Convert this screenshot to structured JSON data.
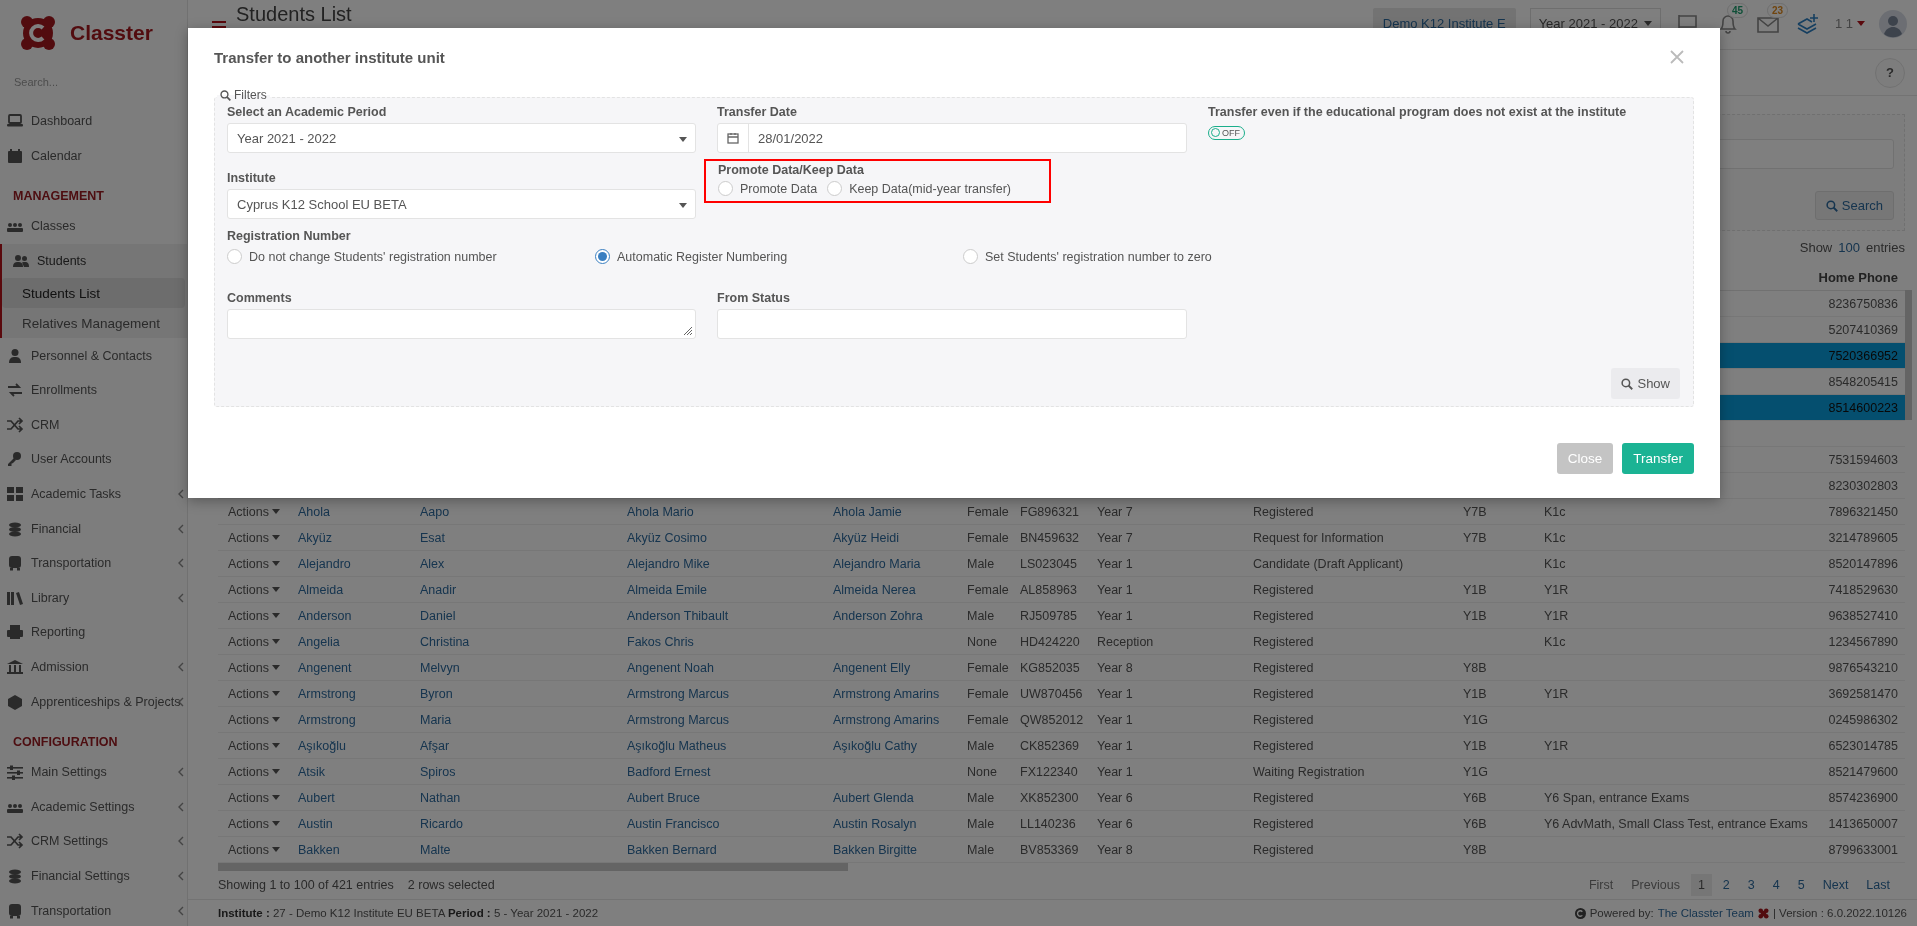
{
  "brand": {
    "name": "Classter",
    "search_placeholder": "Search..."
  },
  "sidebar": [
    {
      "kind": "item",
      "label": "Dashboard",
      "selected": false,
      "has_submenu": false
    },
    {
      "kind": "item",
      "label": "Calendar",
      "selected": false,
      "has_submenu": false
    },
    {
      "kind": "section",
      "label": "MANAGEMENT"
    },
    {
      "kind": "item",
      "label": "Classes",
      "selected": false,
      "has_submenu": false
    },
    {
      "kind": "item",
      "label": "Students",
      "selected": true,
      "has_submenu": false,
      "expanded": true,
      "children": [
        {
          "label": "Students List",
          "selected": true
        },
        {
          "label": "Relatives Management",
          "selected": false
        }
      ]
    },
    {
      "kind": "item",
      "label": "Personnel & Contacts",
      "selected": false,
      "has_submenu": false
    },
    {
      "kind": "item",
      "label": "Enrollments",
      "selected": false,
      "has_submenu": false
    },
    {
      "kind": "item",
      "label": "CRM",
      "selected": false,
      "has_submenu": false
    },
    {
      "kind": "item",
      "label": "User Accounts",
      "selected": false,
      "has_submenu": false
    },
    {
      "kind": "item",
      "label": "Academic Tasks",
      "selected": false,
      "has_submenu": true
    },
    {
      "kind": "item",
      "label": "Financial",
      "selected": false,
      "has_submenu": true
    },
    {
      "kind": "item",
      "label": "Transportation",
      "selected": false,
      "has_submenu": true
    },
    {
      "kind": "item",
      "label": "Library",
      "selected": false,
      "has_submenu": true
    },
    {
      "kind": "item",
      "label": "Reporting",
      "selected": false,
      "has_submenu": false
    },
    {
      "kind": "item",
      "label": "Admission",
      "selected": false,
      "has_submenu": true
    },
    {
      "kind": "item",
      "label": "Apprenticeships & Projects",
      "selected": false,
      "has_submenu": true
    },
    {
      "kind": "section",
      "label": "CONFIGURATION"
    },
    {
      "kind": "item",
      "label": "Main Settings",
      "selected": false,
      "has_submenu": true
    },
    {
      "kind": "item",
      "label": "Academic Settings",
      "selected": false,
      "has_submenu": true
    },
    {
      "kind": "item",
      "label": "CRM Settings",
      "selected": false,
      "has_submenu": true
    },
    {
      "kind": "item",
      "label": "Financial Settings",
      "selected": false,
      "has_submenu": true
    },
    {
      "kind": "item",
      "label": "Transportation",
      "selected": false,
      "has_submenu": true
    }
  ],
  "topbar": {
    "title": "Students List",
    "institute": "Demo K12 Institute E",
    "period": "Year 2021 - 2022",
    "notifications": "45",
    "messages": "23",
    "user": "1 1",
    "help": "?"
  },
  "filters": {
    "search_button": "Search"
  },
  "entries": {
    "show": "Show",
    "count": "100",
    "suffix": "entries"
  },
  "table": {
    "home_phone_header": "Home Phone",
    "rows": [
      {
        "home_phone": "8236750836",
        "selected": false
      },
      {
        "home_phone": "5207410369",
        "selected": false
      },
      {
        "home_phone": "7520366952",
        "selected": true
      },
      {
        "home_phone": "8548205415",
        "selected": false
      },
      {
        "home_phone": "8514600223",
        "selected": true
      },
      {
        "selected": false
      },
      {
        "home_phone": "7531594603",
        "selected": false
      },
      {
        "home_phone": "8230302803",
        "selected": false
      },
      {
        "actions": "Actions",
        "last_name": "Ahola",
        "first_name": "Aapo",
        "father": "Ahola Mario",
        "mother": "Ahola Jamie",
        "gender": "Female",
        "reg_no": "FG896321",
        "year": "Year 7",
        "status": "Registered",
        "class": "Y7B",
        "section": "K1c",
        "home_phone": "7896321450",
        "selected": false
      },
      {
        "actions": "Actions",
        "last_name": "Akyüz",
        "first_name": "Esat",
        "father": "Akyüz Cosimo",
        "mother": "Akyüz Heidi",
        "gender": "Female",
        "reg_no": "BN459632",
        "year": "Year 7",
        "status": "Request for Information",
        "class": "Y7B",
        "section": "K1c",
        "home_phone": "3214789605",
        "selected": false
      },
      {
        "actions": "Actions",
        "last_name": "Alejandro",
        "first_name": "Alex",
        "father": "Alejandro Mike",
        "mother": "Alejandro Maria",
        "gender": "Male",
        "reg_no": "LS023045",
        "year": "Year 1",
        "status": "Candidate (Draft Applicant)",
        "section": "K1c",
        "home_phone": "8520147896",
        "selected": false
      },
      {
        "actions": "Actions",
        "last_name": "Almeida",
        "first_name": "Anadir",
        "father": "Almeida Emile",
        "mother": "Almeida Nerea",
        "gender": "Female",
        "reg_no": "AL858963",
        "year": "Year 1",
        "status": "Registered",
        "class": "Y1B",
        "section": "Y1R",
        "home_phone": "7418529630",
        "selected": false
      },
      {
        "actions": "Actions",
        "last_name": "Anderson",
        "first_name": "Daniel",
        "father": "Anderson Thibault",
        "mother": "Anderson Zohra",
        "gender": "Male",
        "reg_no": "RJ509785",
        "year": "Year 1",
        "status": "Registered",
        "class": "Y1B",
        "section": "Y1R",
        "home_phone": "9638527410",
        "selected": false
      },
      {
        "actions": "Actions",
        "last_name": "Angelia",
        "first_name": "Christina",
        "father": "Fakos Chris",
        "gender": "None",
        "reg_no": "HD424220",
        "year": "Reception",
        "status": "Registered",
        "section": "K1c",
        "home_phone": "1234567890",
        "selected": false
      },
      {
        "actions": "Actions",
        "last_name": "Angenent",
        "first_name": "Melvyn",
        "father": "Angenent Noah",
        "mother": "Angenent Elly",
        "gender": "Female",
        "reg_no": "KG852035",
        "year": "Year 8",
        "status": "Registered",
        "class": "Y8B",
        "home_phone": "9876543210",
        "selected": false
      },
      {
        "actions": "Actions",
        "last_name": "Armstrong",
        "first_name": "Byron",
        "father": "Armstrong Marcus",
        "mother": "Armstrong Amarins",
        "gender": "Female",
        "reg_no": "UW870456",
        "year": "Year 1",
        "status": "Registered",
        "class": "Y1B",
        "section": "Y1R",
        "home_phone": "3692581470",
        "selected": false
      },
      {
        "actions": "Actions",
        "last_name": "Armstrong",
        "first_name": "Maria",
        "father": "Armstrong Marcus",
        "mother": "Armstrong Amarins",
        "gender": "Female",
        "reg_no": "QW852012",
        "year": "Year 1",
        "status": "Registered",
        "class": "Y1G",
        "home_phone": "0245986302",
        "selected": false
      },
      {
        "actions": "Actions",
        "last_name": "Aşıkoğlu",
        "first_name": "Afşar",
        "father": "Aşıkoğlu Matheus",
        "mother": "Aşıkoğlu Cathy",
        "gender": "Male",
        "reg_no": "CK852369",
        "year": "Year 1",
        "status": "Registered",
        "class": "Y1B",
        "section": "Y1R",
        "home_phone": "6523014785",
        "selected": false
      },
      {
        "actions": "Actions",
        "last_name": "Atsik",
        "first_name": "Spiros",
        "father": "Badford Ernest",
        "gender": "None",
        "reg_no": "FX122340",
        "year": "Year 1",
        "status": "Waiting Registration",
        "class": "Y1G",
        "home_phone": "8521479600",
        "selected": false
      },
      {
        "actions": "Actions",
        "last_name": "Aubert",
        "first_name": "Nathan",
        "father": "Aubert Bruce",
        "mother": "Aubert Glenda",
        "gender": "Male",
        "reg_no": "XK852300",
        "year": "Year 6",
        "status": "Registered",
        "class": "Y6B",
        "section": "Y6 Span, entrance Exams",
        "home_phone": "8574236900",
        "selected": false
      },
      {
        "actions": "Actions",
        "last_name": "Austin",
        "first_name": "Ricardo",
        "father": "Austin Francisco",
        "mother": "Austin Rosalyn",
        "gender": "Male",
        "reg_no": "LL140236",
        "year": "Year 6",
        "status": "Registered",
        "class": "Y6B",
        "section": "Y6 AdvMath, Small Class Test, entrance Exams",
        "home_phone": "1413650007",
        "selected": false
      },
      {
        "actions": "Actions",
        "last_name": "Bakken",
        "first_name": "Malte",
        "father": "Bakken Bernard",
        "mother": "Bakken Birgitte",
        "gender": "Male",
        "reg_no": "BV853369",
        "year": "Year 8",
        "status": "Registered",
        "class": "Y8B",
        "home_phone": "8799633001",
        "selected": false
      }
    ]
  },
  "table_footer": {
    "info": "Showing 1 to 100 of 421 entries",
    "selection": "2 rows selected",
    "pagination": [
      {
        "label": "First",
        "selected": false,
        "disabled": true
      },
      {
        "label": "Previous",
        "selected": false,
        "disabled": true
      },
      {
        "label": "1",
        "selected": true,
        "disabled": false
      },
      {
        "label": "2",
        "selected": false,
        "disabled": false
      },
      {
        "label": "3",
        "selected": false,
        "disabled": false
      },
      {
        "label": "4",
        "selected": false,
        "disabled": false
      },
      {
        "label": "5",
        "selected": false,
        "disabled": false
      },
      {
        "label": "Next",
        "selected": false,
        "disabled": false
      },
      {
        "label": "Last",
        "selected": false,
        "disabled": false
      }
    ]
  },
  "status_bar": {
    "context": "**Institute :** 27 - Demo K12 Institute EU BETA **Period :** 5 - Year 2021 - 2022",
    "powered_by": "Powered by:",
    "team": "The Classter Team",
    "version": "| Version : 6.0.2022.10126"
  },
  "modal": {
    "title": "Transfer to another institute unit",
    "legend": "Filters",
    "academic_period": {
      "label": "Select an Academic Period",
      "value": "Year 2021 - 2022"
    },
    "transfer_date": {
      "label": "Transfer Date",
      "value": "28/01/2022"
    },
    "transfer_even": {
      "label": "Transfer even if the educational program does not exist at the institute",
      "on": false,
      "state_text": "OFF"
    },
    "institute": {
      "label": "Institute",
      "value": "Cyprus K12 School EU BETA"
    },
    "promote_keep": {
      "label": "Promote Data/Keep Data",
      "highlighted": true,
      "options": [
        {
          "label": "Promote Data",
          "selected": false
        },
        {
          "label": "Keep Data(mid-year transfer)",
          "selected": false
        }
      ]
    },
    "registration_number": {
      "label": "Registration Number",
      "options": [
        {
          "label": "Do not change Students' registration number",
          "selected": false
        },
        {
          "label": "Automatic Register Numbering",
          "selected": true
        },
        {
          "label": "Set Students' registration number to zero",
          "selected": false
        }
      ]
    },
    "comments": {
      "label": "Comments"
    },
    "from_status": {
      "label": "From Status"
    },
    "show_button": "Show",
    "buttons": [
      {
        "label": "Close",
        "kind": "secondary"
      },
      {
        "label": "Transfer",
        "kind": "primary"
      }
    ]
  }
}
